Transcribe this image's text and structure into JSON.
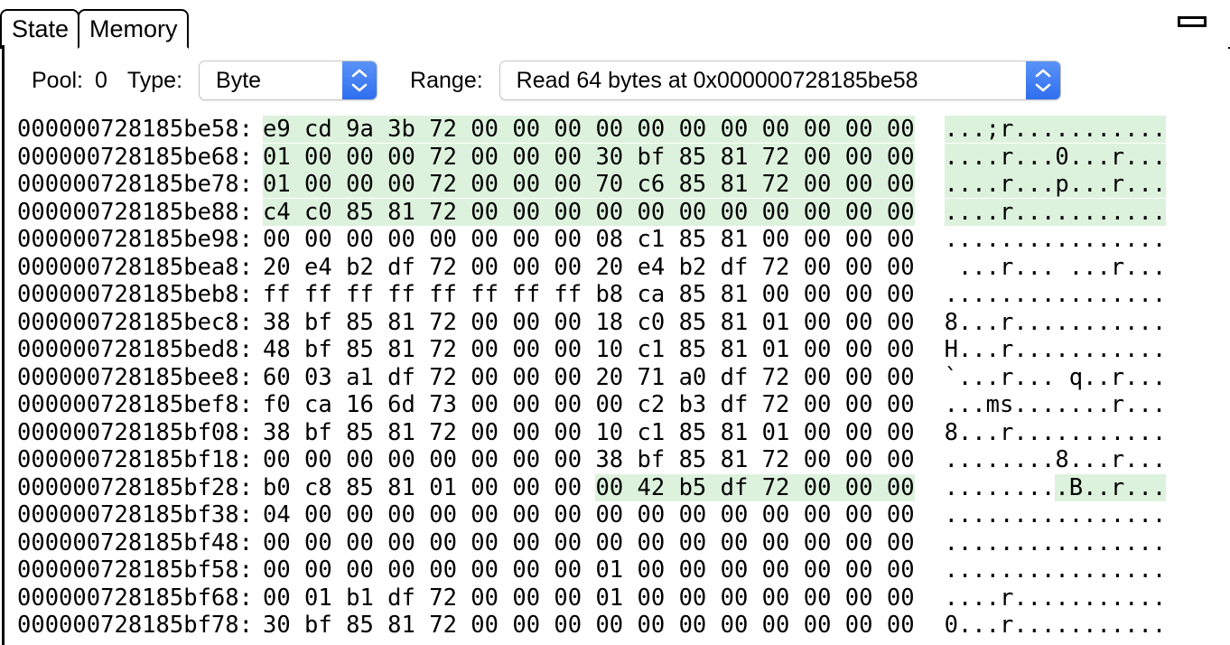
{
  "window": {
    "controls": {
      "minimize_icon": "minimize-icon"
    }
  },
  "tabs": [
    {
      "label": "State",
      "active": false
    },
    {
      "label": "Memory",
      "active": true
    }
  ],
  "toolbar": {
    "pool_label": "Pool:",
    "pool_value": "0",
    "type_label": "Type:",
    "type_value": "Byte",
    "range_label": "Range:",
    "range_value": "Read 64 bytes at 0x000000728185be58",
    "stepper_icon": "stepper-up-down-icon",
    "accent_color": "#2f6ff0"
  },
  "hexdump": {
    "highlight_color": "#ddf2dd",
    "bytes_per_row": 16,
    "rows": [
      {
        "address": "000000728185be58",
        "bytes": "e9 cd 9a 3b 72 00 00 00 00 00 00 00 00 00 00 00",
        "ascii": "...;r...........",
        "highlight": "full"
      },
      {
        "address": "000000728185be68",
        "bytes": "01 00 00 00 72 00 00 00 30 bf 85 81 72 00 00 00",
        "ascii": "....r...0...r...",
        "highlight": "full"
      },
      {
        "address": "000000728185be78",
        "bytes": "01 00 00 00 72 00 00 00 70 c6 85 81 72 00 00 00",
        "ascii": "....r...p...r...",
        "highlight": "full"
      },
      {
        "address": "000000728185be88",
        "bytes": "c4 c0 85 81 72 00 00 00 00 00 00 00 00 00 00 00",
        "ascii": "....r...........",
        "highlight": "full"
      },
      {
        "address": "000000728185be98",
        "bytes": "00 00 00 00 00 00 00 00 08 c1 85 81 00 00 00 00",
        "ascii": "................",
        "highlight": "none"
      },
      {
        "address": "000000728185bea8",
        "bytes": "20 e4 b2 df 72 00 00 00 20 e4 b2 df 72 00 00 00",
        "ascii": " ...r... ...r...",
        "highlight": "none"
      },
      {
        "address": "000000728185beb8",
        "bytes": "ff ff ff ff ff ff ff ff b8 ca 85 81 00 00 00 00",
        "ascii": "................",
        "highlight": "none"
      },
      {
        "address": "000000728185bec8",
        "bytes": "38 bf 85 81 72 00 00 00 18 c0 85 81 01 00 00 00",
        "ascii": "8...r...........",
        "highlight": "none"
      },
      {
        "address": "000000728185bed8",
        "bytes": "48 bf 85 81 72 00 00 00 10 c1 85 81 01 00 00 00",
        "ascii": "H...r...........",
        "highlight": "none"
      },
      {
        "address": "000000728185bee8",
        "bytes": "60 03 a1 df 72 00 00 00 20 71 a0 df 72 00 00 00",
        "ascii": "`...r... q..r...",
        "highlight": "none"
      },
      {
        "address": "000000728185bef8",
        "bytes": "f0 ca 16 6d 73 00 00 00 00 c2 b3 df 72 00 00 00",
        "ascii": "...ms.......r...",
        "highlight": "none"
      },
      {
        "address": "000000728185bf08",
        "bytes": "38 bf 85 81 72 00 00 00 10 c1 85 81 01 00 00 00",
        "ascii": "8...r...........",
        "highlight": "none"
      },
      {
        "address": "000000728185bf18",
        "bytes": "00 00 00 00 00 00 00 00 38 bf 85 81 72 00 00 00",
        "ascii": "........8...r...",
        "highlight": "none"
      },
      {
        "address": "000000728185bf28",
        "bytes": "b0 c8 85 81 01 00 00 00 00 42 b5 df 72 00 00 00",
        "ascii": ".........B..r...",
        "highlight": "partial",
        "highlight_start_byte": 8,
        "highlight_end_byte": 16
      },
      {
        "address": "000000728185bf38",
        "bytes": "04 00 00 00 00 00 00 00 00 00 00 00 00 00 00 00",
        "ascii": "................",
        "highlight": "none"
      },
      {
        "address": "000000728185bf48",
        "bytes": "00 00 00 00 00 00 00 00 00 00 00 00 00 00 00 00",
        "ascii": "................",
        "highlight": "none"
      },
      {
        "address": "000000728185bf58",
        "bytes": "00 00 00 00 00 00 00 00 01 00 00 00 00 00 00 00",
        "ascii": "................",
        "highlight": "none"
      },
      {
        "address": "000000728185bf68",
        "bytes": "00 01 b1 df 72 00 00 00 01 00 00 00 00 00 00 00",
        "ascii": "....r...........",
        "highlight": "none"
      },
      {
        "address": "000000728185bf78",
        "bytes": "30 bf 85 81 72 00 00 00 00 00 00 00 00 00 00 00",
        "ascii": "0...r...........",
        "highlight": "none"
      }
    ]
  }
}
